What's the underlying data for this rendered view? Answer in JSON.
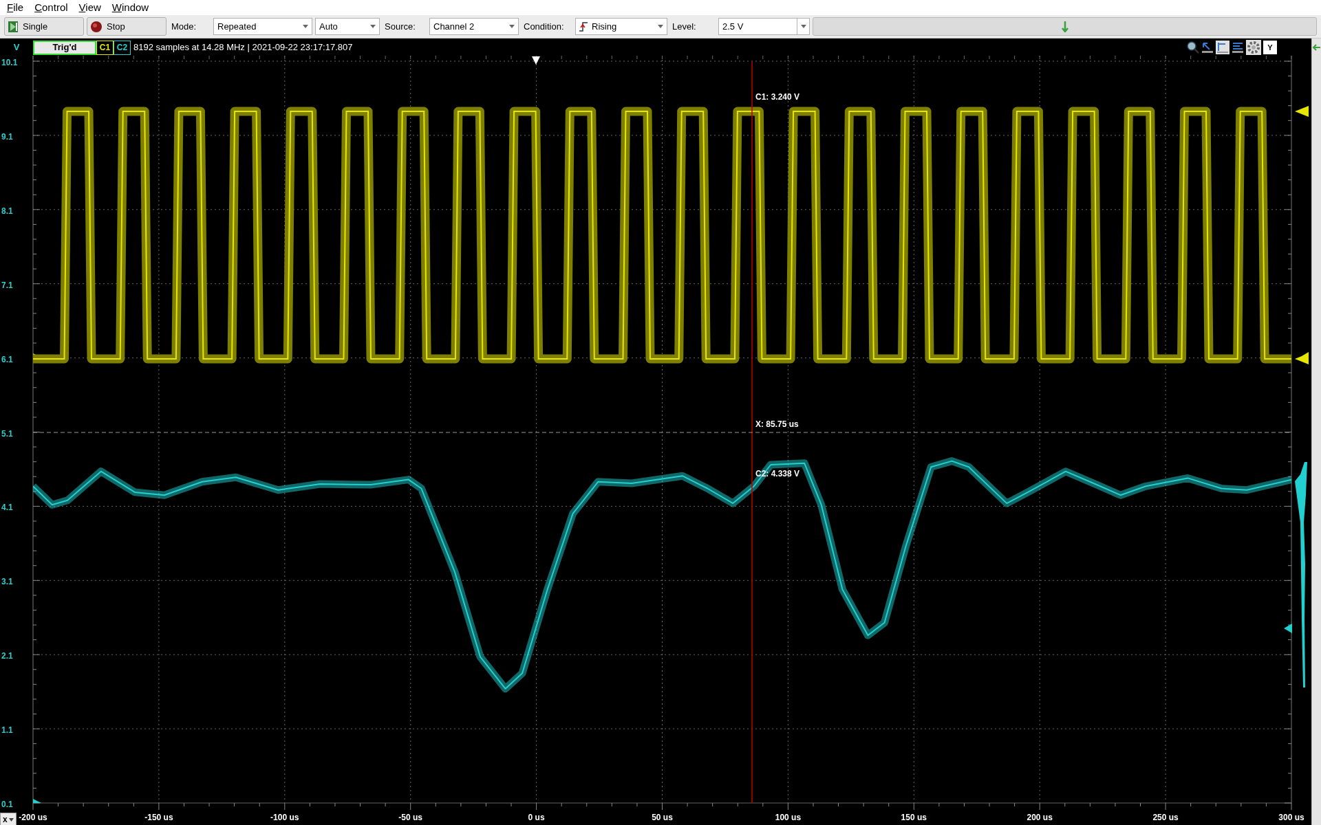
{
  "menu": [
    {
      "label": "File"
    },
    {
      "label": "Control"
    },
    {
      "label": "View"
    },
    {
      "label": "Window"
    }
  ],
  "toolbar": {
    "single_button": "Single",
    "stop_button": "Stop",
    "mode_label": "Mode:",
    "mode": "Repeated",
    "mode_2": "Auto",
    "source_label": "Source:",
    "source": "Channel 2",
    "condition_label": "Condition:",
    "condition": "Rising",
    "level_label": "Level:",
    "level": "2.5 V"
  },
  "status": {
    "axis_unit": "V",
    "trigger_state": "Trig'd",
    "channels": [
      {
        "label": "C1",
        "color": "#e6e600"
      },
      {
        "label": "C2",
        "color": "#22d0d0"
      }
    ],
    "info": "8192 samples at 14.28 MHz | 2021-09-22 23:17:17.807",
    "y_button": "Y"
  },
  "plot": {
    "chart_data": {
      "type": "line",
      "grid": true,
      "xlim": [
        -200,
        300
      ],
      "ylim": [
        0.1,
        10.1
      ],
      "yticks": [
        {
          "value": 10.1,
          "label": "10.1"
        },
        {
          "value": 9.1,
          "label": "9.1"
        },
        {
          "value": 8.1,
          "label": "8.1"
        },
        {
          "value": 7.1,
          "label": "7.1"
        },
        {
          "value": 6.1,
          "label": "6.1"
        },
        {
          "value": 5.1,
          "label": "5.1"
        },
        {
          "value": 4.1,
          "label": "4.1"
        },
        {
          "value": 3.1,
          "label": "3.1"
        },
        {
          "value": 2.1,
          "label": "2.1"
        },
        {
          "value": 1.1,
          "label": "1.1"
        },
        {
          "value": 0.1,
          "label": "0.1"
        }
      ],
      "xticks": [
        {
          "value": -200,
          "label": "-200 us"
        },
        {
          "value": -150,
          "label": "-150 us"
        },
        {
          "value": -100,
          "label": "-100 us"
        },
        {
          "value": -50,
          "label": "-50 us"
        },
        {
          "value": 0,
          "label": "0 us"
        },
        {
          "value": 50,
          "label": "50 us"
        },
        {
          "value": 100,
          "label": "100 us"
        },
        {
          "value": 150,
          "label": "150 us"
        },
        {
          "value": 200,
          "label": "200 us"
        },
        {
          "value": 250,
          "label": "250 us"
        },
        {
          "value": 300,
          "label": "300 us"
        }
      ],
      "x": [
        -200,
        -192.4,
        -186.3,
        -173,
        -159.6,
        -147.8,
        -132.8,
        -119.4,
        -102.6,
        -85.9,
        -65.8,
        -50.8,
        -45.7,
        -32.4,
        -22.3,
        -12.3,
        -5.6,
        4.4,
        14.5,
        24.5,
        37.9,
        58,
        68,
        78.1,
        86.4,
        93.1,
        106.5,
        113.2,
        121.6,
        131.7,
        138.3,
        146.7,
        156.8,
        165.1,
        171.8,
        186.9,
        195.3,
        210.3,
        222,
        232.1,
        242.1,
        258.8,
        272.2,
        282.3,
        300
      ],
      "series": [
        {
          "color": "#22d0d0",
          "values": [
            4.37,
            4.12,
            4.18,
            4.57,
            4.29,
            4.25,
            4.43,
            4.49,
            4.32,
            4.4,
            4.39,
            4.46,
            4.34,
            3.21,
            2.07,
            1.64,
            1.85,
            2.98,
            4,
            4.43,
            4.41,
            4.51,
            4.34,
            4.14,
            4.37,
            4.66,
            4.68,
            4.12,
            2.98,
            2.36,
            2.53,
            3.55,
            4.63,
            4.71,
            4.63,
            4.14,
            4.29,
            4.57,
            4.4,
            4.25,
            4.37,
            4.48,
            4.34,
            4.32,
            4.46
          ]
        }
      ]
    },
    "cursor": {
      "c1": "C1: 3.240 V",
      "x": "X: 85.75 us",
      "c2": "C2: 4.338 V"
    },
    "axis_button": "x"
  }
}
